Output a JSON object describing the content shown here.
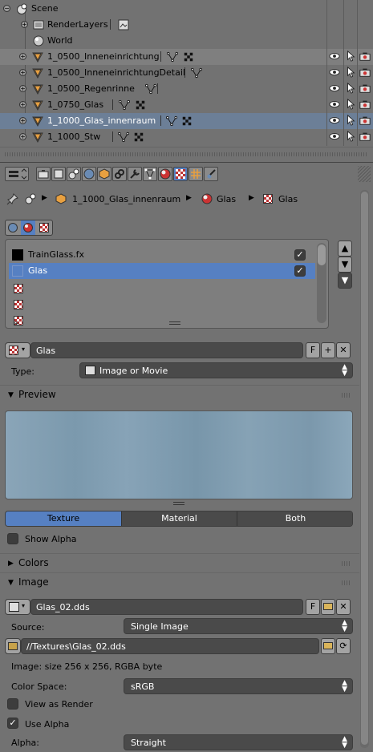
{
  "outliner": {
    "scene_label": "Scene",
    "render_layers_label": "RenderLayers",
    "world_label": "World",
    "objects": [
      {
        "name": "1_0500_Inneneinrichtung",
        "selected": false
      },
      {
        "name": "1_0500_InneneinrichtungDetail",
        "selected": false
      },
      {
        "name": "1_0500_Regenrinne",
        "selected": false
      },
      {
        "name": "1_0750_Glas",
        "selected": false
      },
      {
        "name": "1_1000_Glas_innenraum",
        "selected": true
      },
      {
        "name": "1_1000_Stw",
        "selected": false
      }
    ]
  },
  "breadcrumb": {
    "object": "1_1000_Glas_innenraum",
    "material": "Glas",
    "texture": "Glas"
  },
  "texture_slots": {
    "items": [
      {
        "name": "TrainGlass.fx",
        "checked": true
      },
      {
        "name": "Glas",
        "checked": true,
        "active": true
      }
    ]
  },
  "texture_datablock": {
    "name": "Glas",
    "fake_user": "F"
  },
  "type": {
    "label": "Type:",
    "value": "Image or Movie"
  },
  "preview_panel": {
    "title": "Preview",
    "tabs": [
      "Texture",
      "Material",
      "Both"
    ],
    "active_tab": "Texture",
    "show_alpha_label": "Show Alpha"
  },
  "colors_panel": {
    "title": "Colors"
  },
  "image_panel": {
    "title": "Image",
    "image_name": "Glas_02.dds",
    "fake_user": "F",
    "source_label": "Source:",
    "source_value": "Single Image",
    "filepath": "//Textures\\Glas_02.dds",
    "info": "Image: size 256 x 256, RGBA byte",
    "color_space_label": "Color Space:",
    "color_space_value": "sRGB",
    "view_as_render_label": "View as Render",
    "use_alpha_label": "Use Alpha",
    "alpha_label": "Alpha:",
    "alpha_value": "Straight"
  },
  "colors": {
    "selection": "#5680c2",
    "highlight_row": "#6c7f97",
    "panel_bg": "#727272",
    "preview_glass": "#7a99ad"
  }
}
